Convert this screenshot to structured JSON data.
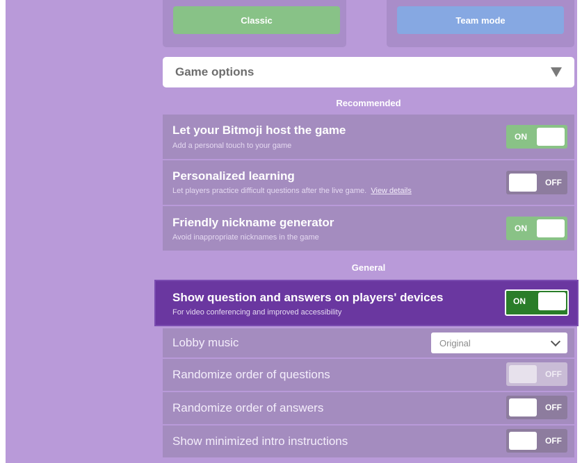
{
  "mode_buttons": {
    "classic": "Classic",
    "team": "Team mode"
  },
  "game_options": {
    "title": "Game options"
  },
  "sections": {
    "recommended": "Recommended",
    "general": "General"
  },
  "recommended_rows": [
    {
      "label": "Let your Bitmoji host the game",
      "sub": "Add a personal touch to your game",
      "toggle": "ON"
    },
    {
      "label": "Personalized learning",
      "sub": "Let players practice difficult questions after the live game.",
      "link": "View details",
      "toggle": "OFF"
    },
    {
      "label": "Friendly nickname generator",
      "sub": "Avoid inappropriate nicknames in the game",
      "toggle": "ON"
    }
  ],
  "general_rows": {
    "show_qa": {
      "label": "Show question and answers on players' devices",
      "sub": "For video conferencing and improved accessibility",
      "toggle": "ON"
    },
    "lobby_music": {
      "label": "Lobby music",
      "selected": "Original"
    },
    "randomize_questions": {
      "label": "Randomize order of questions",
      "toggle": "OFF"
    },
    "randomize_answers": {
      "label": "Randomize order of answers",
      "toggle": "OFF"
    },
    "minimized_intro": {
      "label": "Show minimized intro instructions",
      "toggle": "OFF"
    }
  },
  "colors": {
    "background": "#b99ad9",
    "toggle_on": "#89c286",
    "toggle_on_focused": "#2a7d29",
    "highlight_row": "#6a37a0"
  }
}
